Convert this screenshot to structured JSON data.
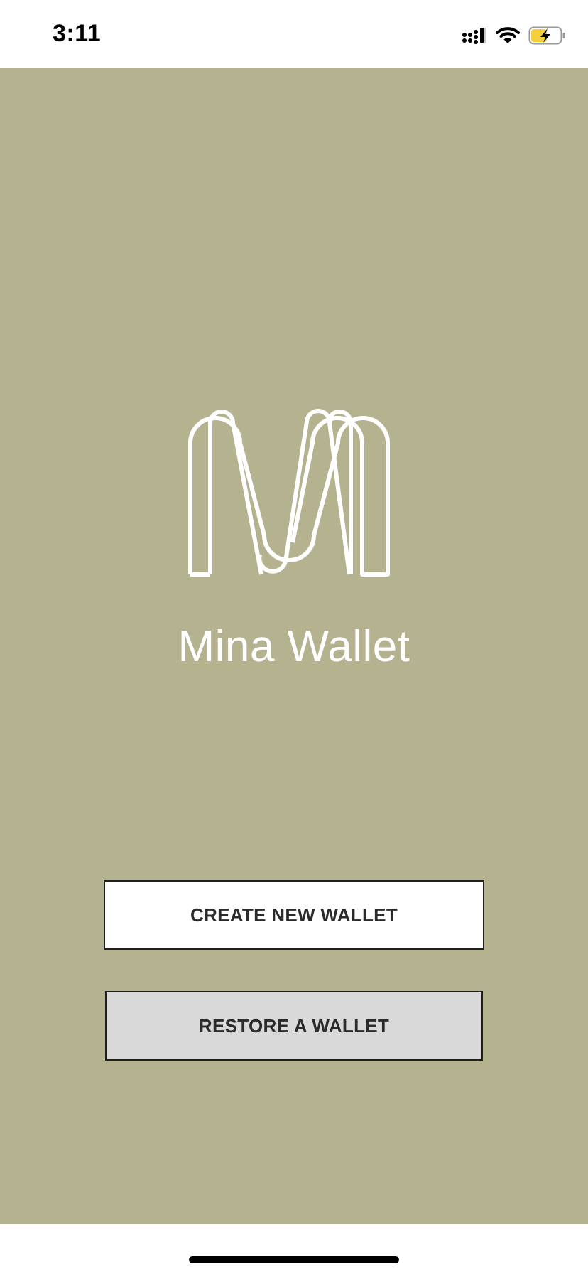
{
  "status_bar": {
    "time": "3:11",
    "icons": [
      "cellular-signal-icon",
      "wifi-icon",
      "battery-charging-icon"
    ]
  },
  "app": {
    "title": "Mina Wallet",
    "logo_icon": "mina-logo-icon"
  },
  "buttons": {
    "create_label": "CREATE NEW WALLET",
    "restore_label": "RESTORE A WALLET"
  },
  "colors": {
    "background": "#b5b290",
    "create_button_bg": "#ffffff",
    "restore_button_bg": "#d9d9d9",
    "battery_fill": "#f4d03f"
  }
}
